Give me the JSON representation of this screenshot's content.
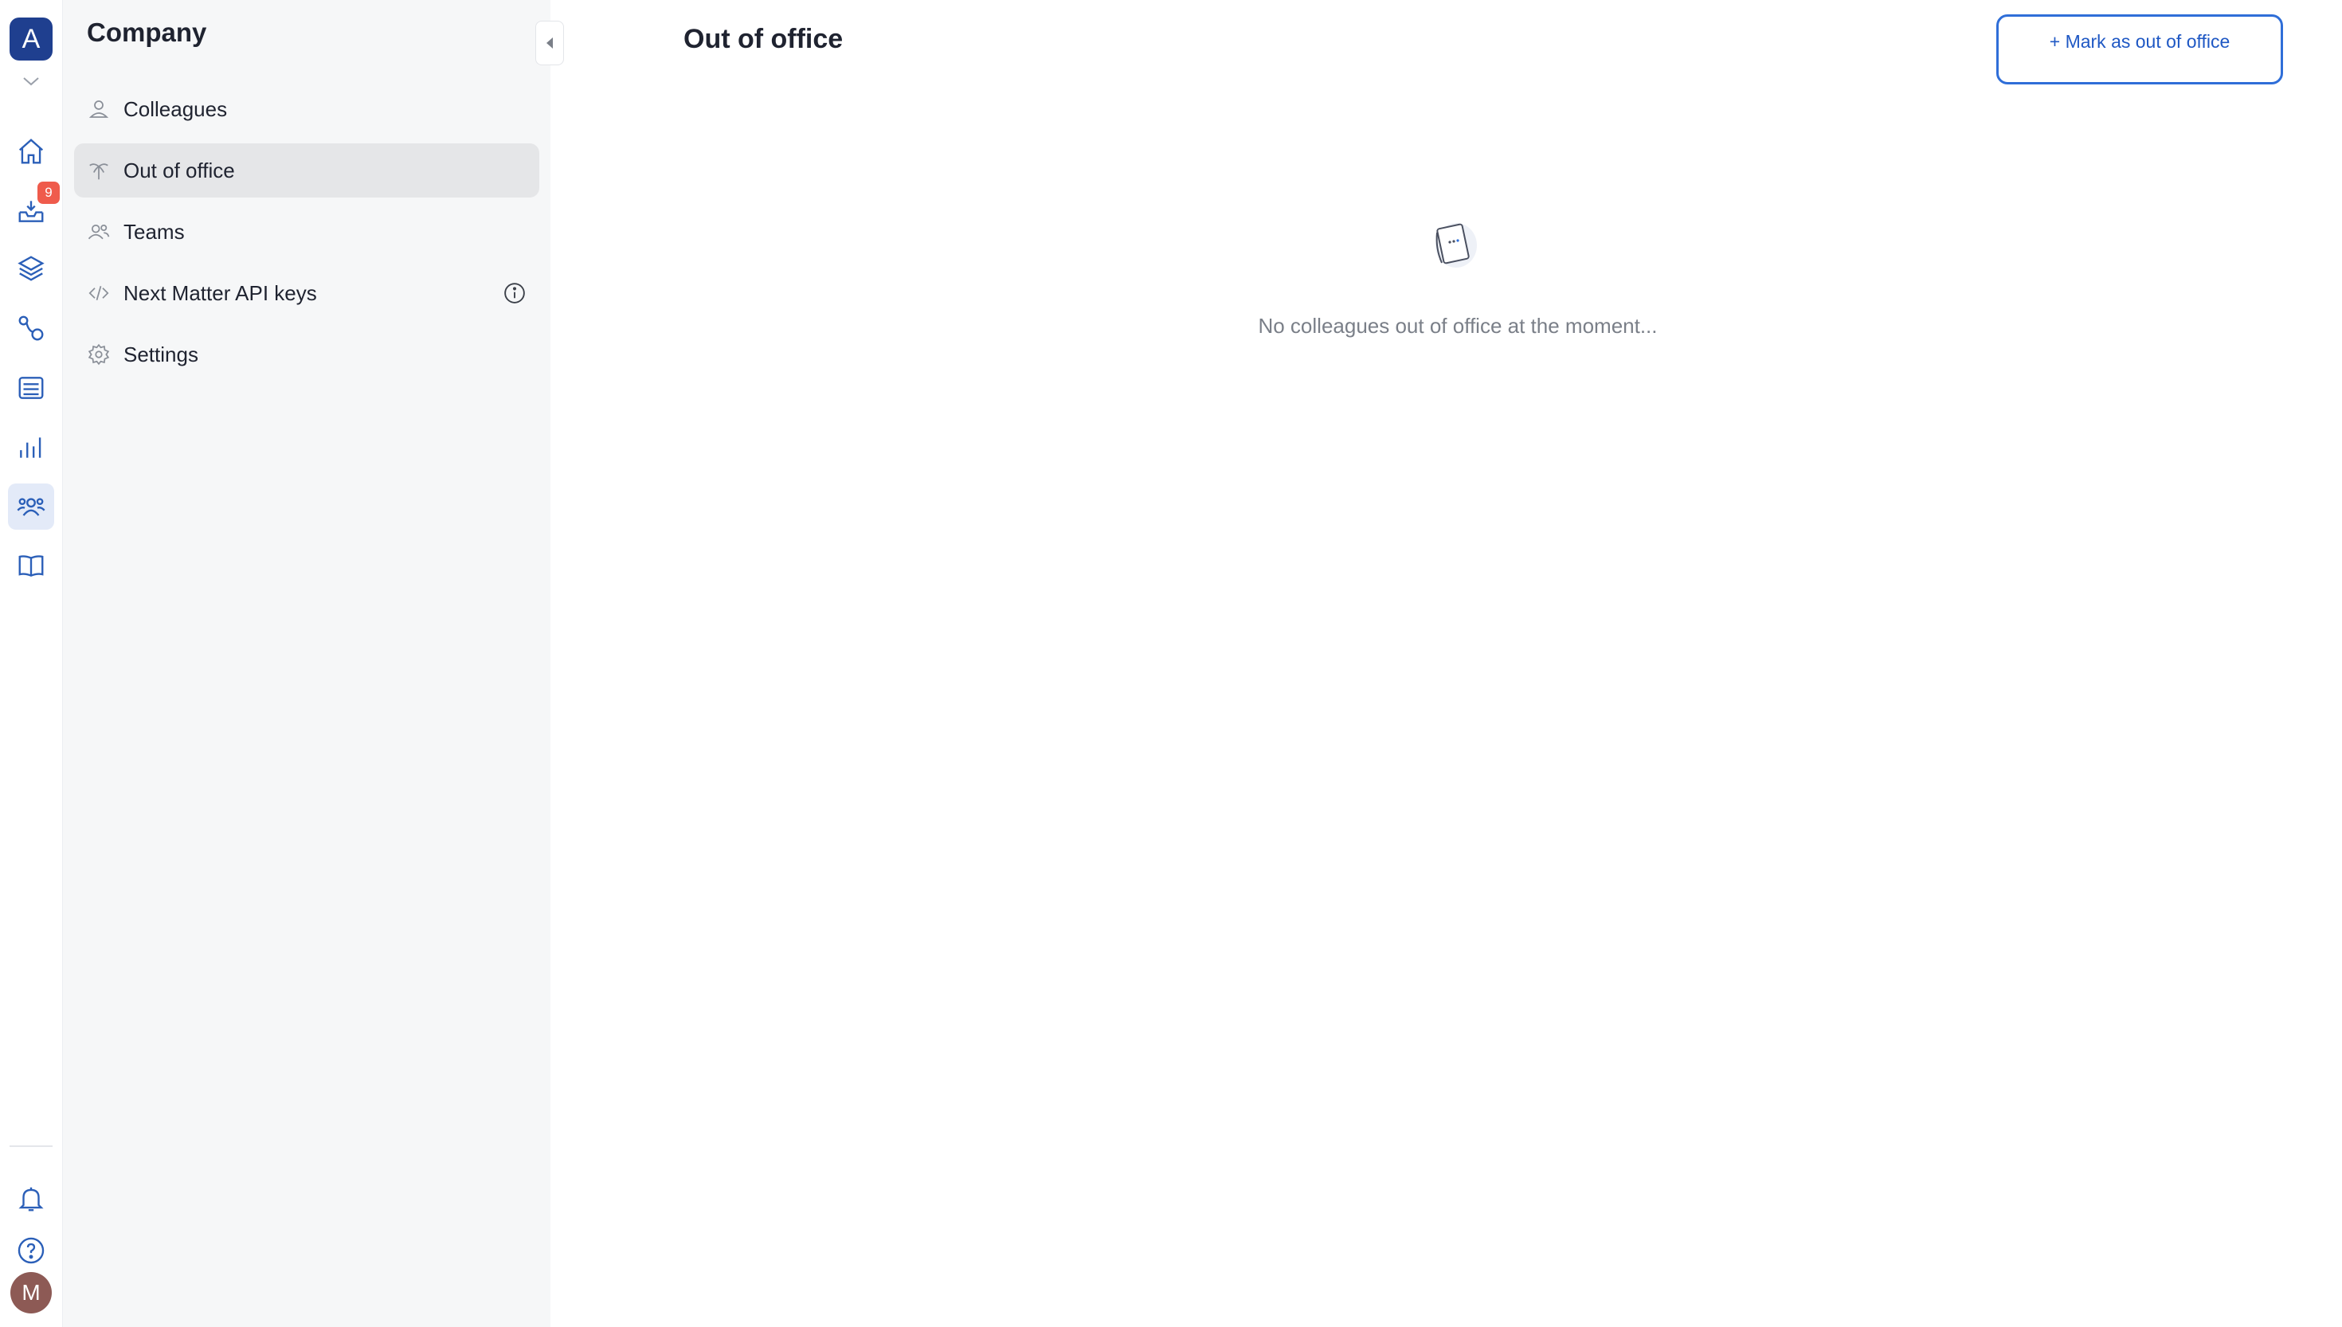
{
  "app": {
    "logo_letter": "A"
  },
  "rail": {
    "items": [
      {
        "name": "home",
        "icon": "home-icon"
      },
      {
        "name": "inbox",
        "icon": "inbox-icon",
        "badge": "9"
      },
      {
        "name": "layers",
        "icon": "layers-icon"
      },
      {
        "name": "workflows",
        "icon": "workflow-icon"
      },
      {
        "name": "list",
        "icon": "list-icon"
      },
      {
        "name": "analytics",
        "icon": "bar-chart-icon"
      },
      {
        "name": "company",
        "icon": "users-icon",
        "active": true
      },
      {
        "name": "docs",
        "icon": "book-icon"
      }
    ],
    "bottom": [
      {
        "name": "notifications",
        "icon": "bell-icon"
      },
      {
        "name": "help",
        "icon": "help-icon"
      }
    ],
    "avatar_initial": "M"
  },
  "sidebar": {
    "title": "Company",
    "items": [
      {
        "label": "Colleagues",
        "icon": "user-icon"
      },
      {
        "label": "Out of office",
        "icon": "palm-tree-icon",
        "active": true
      },
      {
        "label": "Teams",
        "icon": "team-icon"
      },
      {
        "label": "Next Matter API keys",
        "icon": "code-icon",
        "info": "info-icon"
      },
      {
        "label": "Settings",
        "icon": "gear-icon"
      }
    ]
  },
  "main": {
    "title": "Out of office",
    "primary_button": "+ Mark as out of office",
    "empty_state": {
      "icon": "paper-note-icon",
      "message": "No colleagues out of office at the moment..."
    }
  },
  "colors": {
    "accent": "#2f6ed8",
    "logo_bg": "#1f3f8f",
    "badge": "#ef5b4c",
    "active_nav": "#e5e6e8",
    "sidebar_bg": "#f6f7f8"
  }
}
